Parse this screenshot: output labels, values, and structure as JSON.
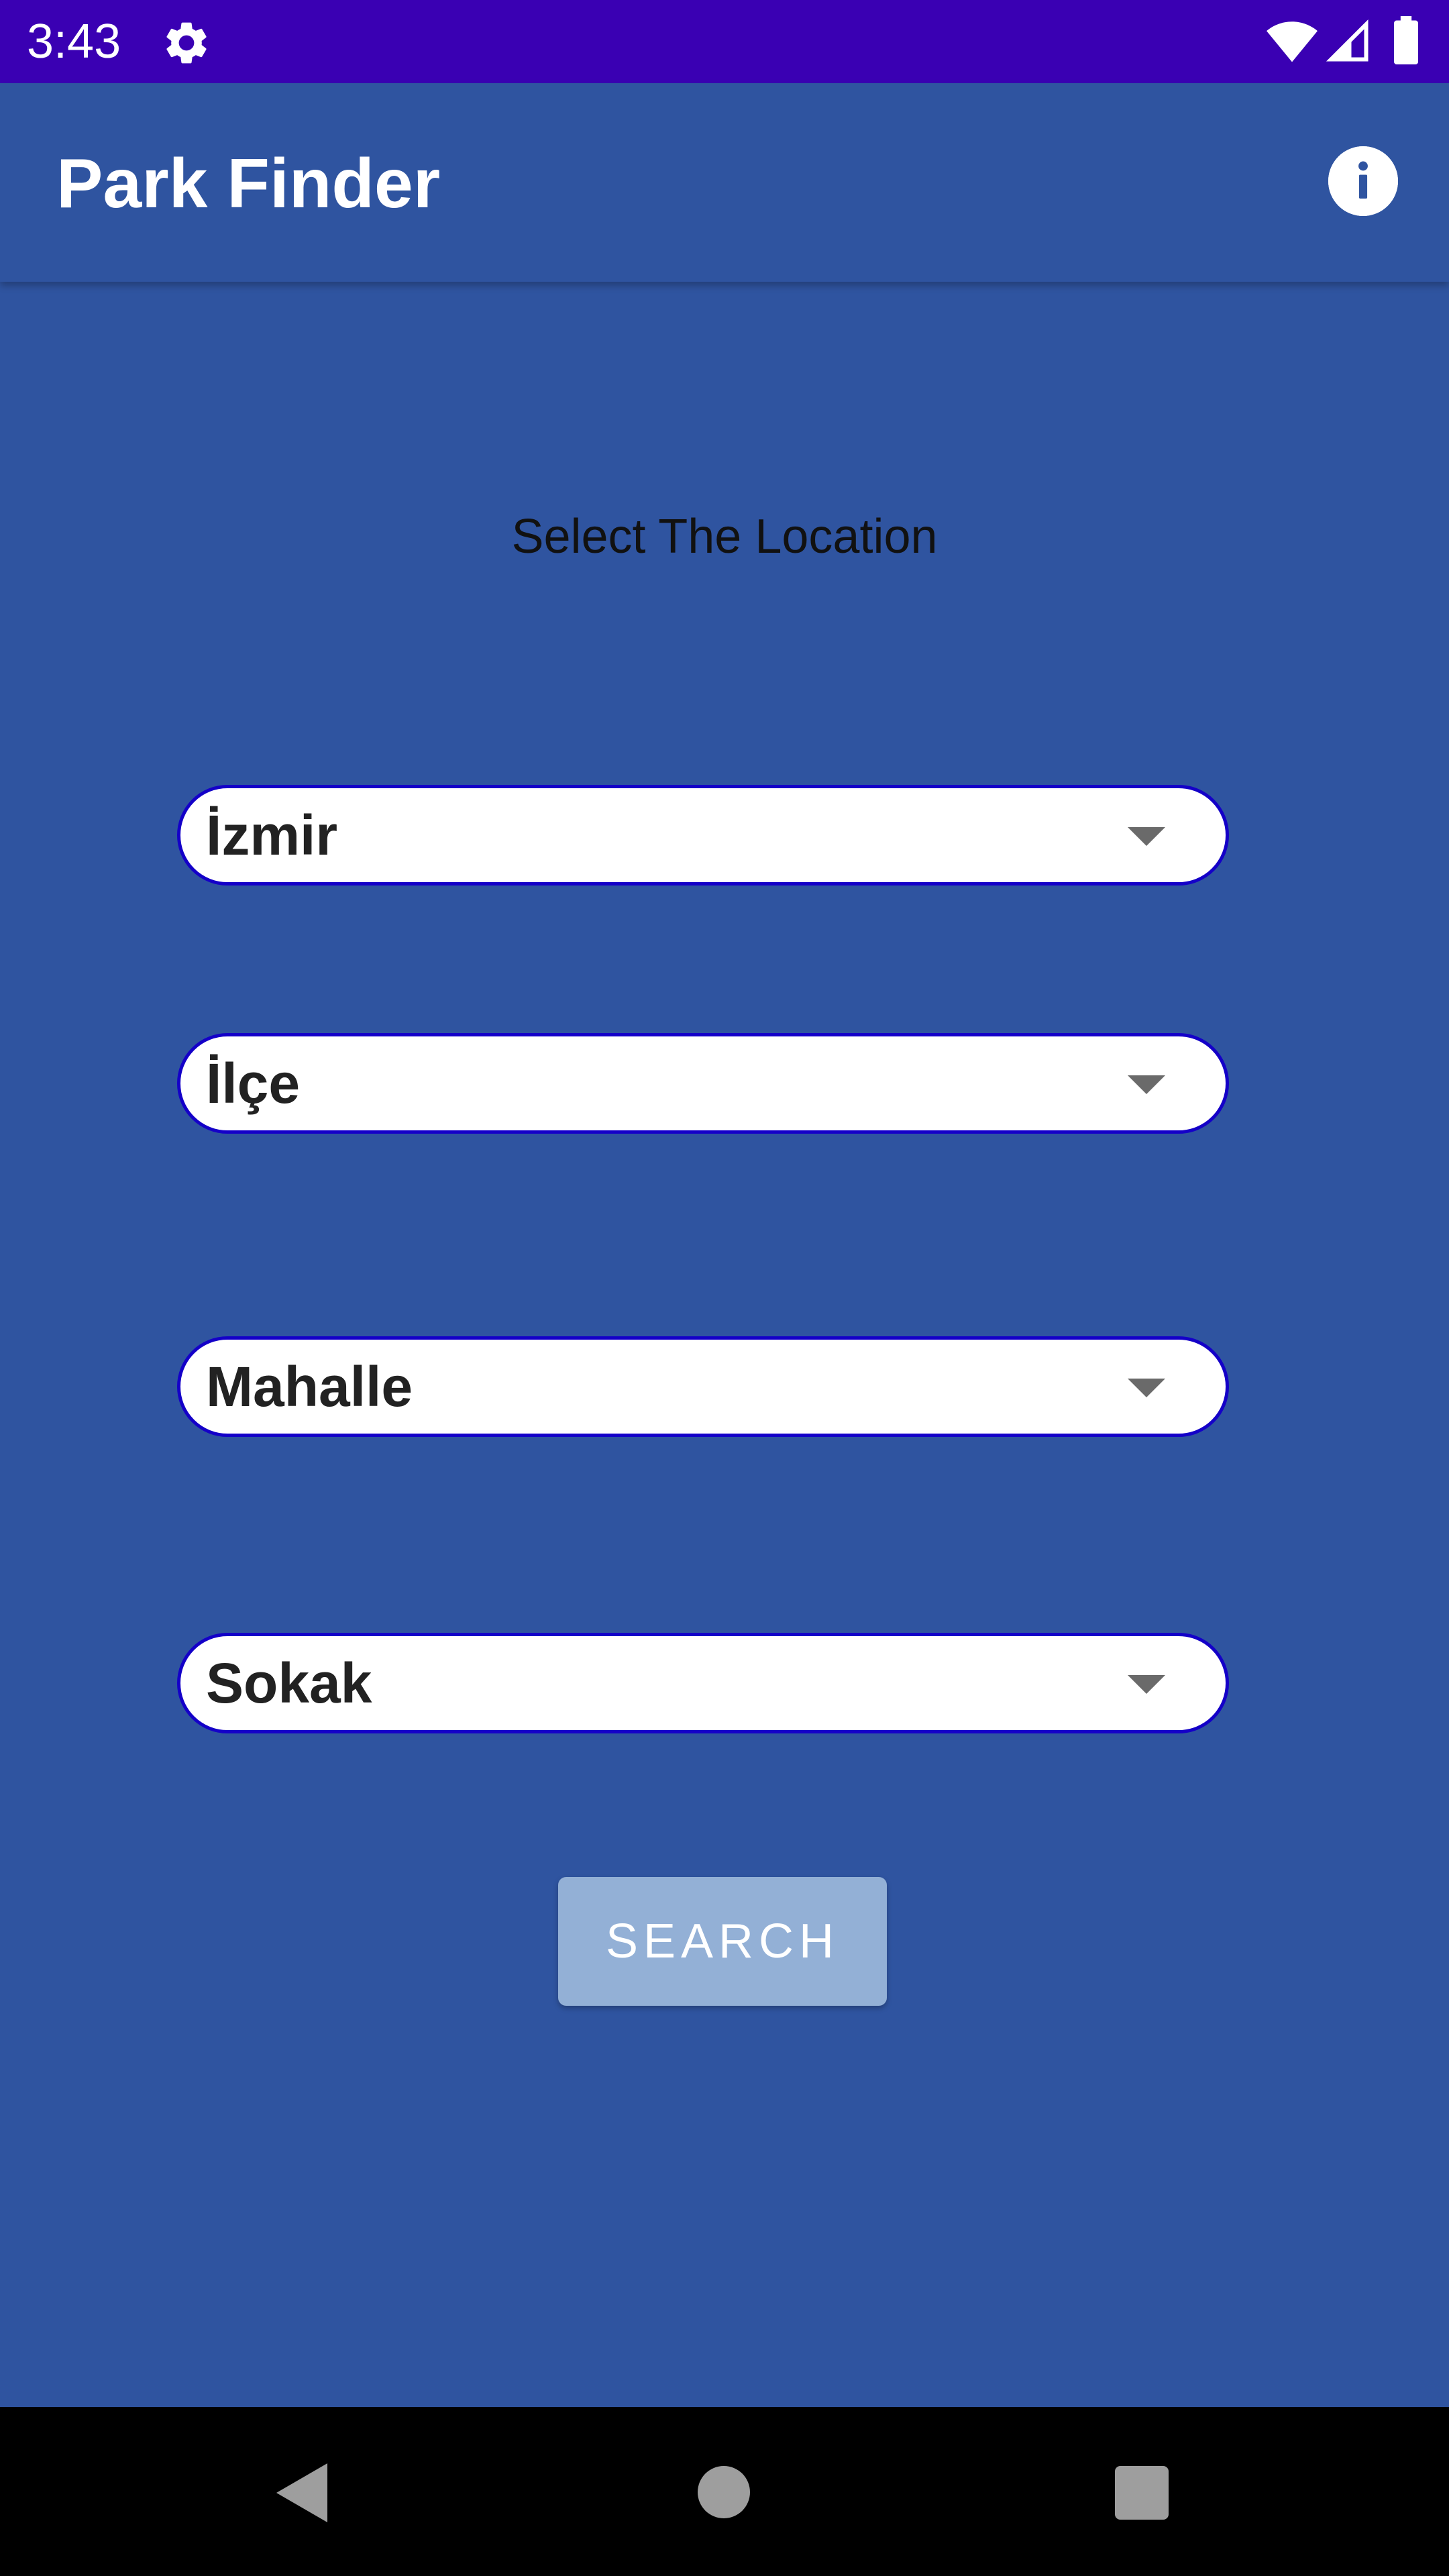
{
  "status_bar": {
    "time": "3:43",
    "icons": [
      "gear-icon",
      "wifi-icon",
      "cell-signal-icon",
      "battery-icon"
    ],
    "background": "#3a00b3"
  },
  "app_bar": {
    "title": "Park Finder",
    "action_icon": "info-icon",
    "background": "#2f54a0"
  },
  "main": {
    "heading": "Select The Location",
    "spinners": [
      {
        "label": "İzmir"
      },
      {
        "label": "İlçe"
      },
      {
        "label": "Mahalle"
      },
      {
        "label": "Sokak"
      }
    ],
    "search_label": "SEARCH"
  },
  "nav_bar": {
    "icons": [
      "back-icon",
      "home-icon",
      "recents-icon"
    ]
  },
  "colors": {
    "page_background": "#2f54a0",
    "spinner_border": "#1400c8",
    "search_button": "#93b0d6"
  }
}
